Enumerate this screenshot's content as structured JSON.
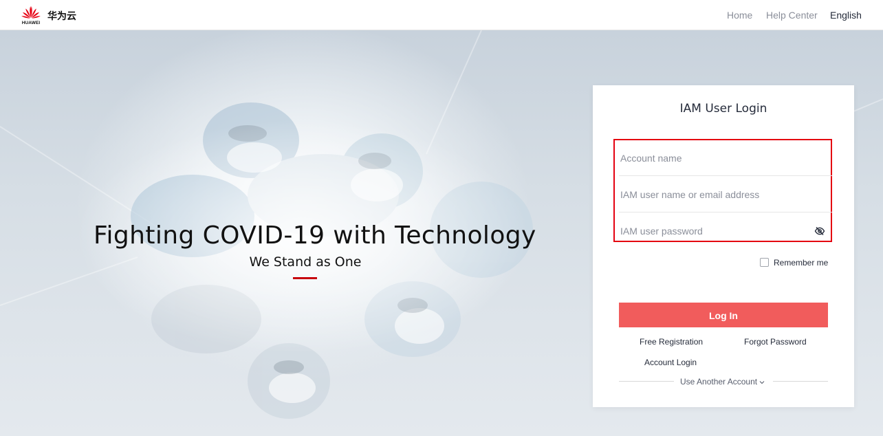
{
  "header": {
    "logo_text": "HUAWEI",
    "brand": "华为云",
    "nav": {
      "home": "Home",
      "help_center": "Help Center",
      "language": "English"
    }
  },
  "hero": {
    "title": "Fighting COVID-19 with Technology",
    "subtitle": "We Stand as One",
    "accent_color": "#c7000b"
  },
  "login": {
    "title": "IAM User Login",
    "fields": {
      "account_name": {
        "placeholder": "Account name",
        "value": ""
      },
      "iam_user": {
        "placeholder": "IAM user name or email address",
        "value": ""
      },
      "password": {
        "placeholder": "IAM user password",
        "value": ""
      }
    },
    "password_toggle_icon": "eye-hidden-icon",
    "remember_me": {
      "label": "Remember me",
      "checked": false
    },
    "login_button": "Log In",
    "login_button_color": "#f15c5c",
    "highlight_color": "#e4000f",
    "links": {
      "free_registration": "Free Registration",
      "forgot_password": "Forgot Password",
      "account_login": "Account Login",
      "use_another_account": "Use Another Account"
    }
  }
}
